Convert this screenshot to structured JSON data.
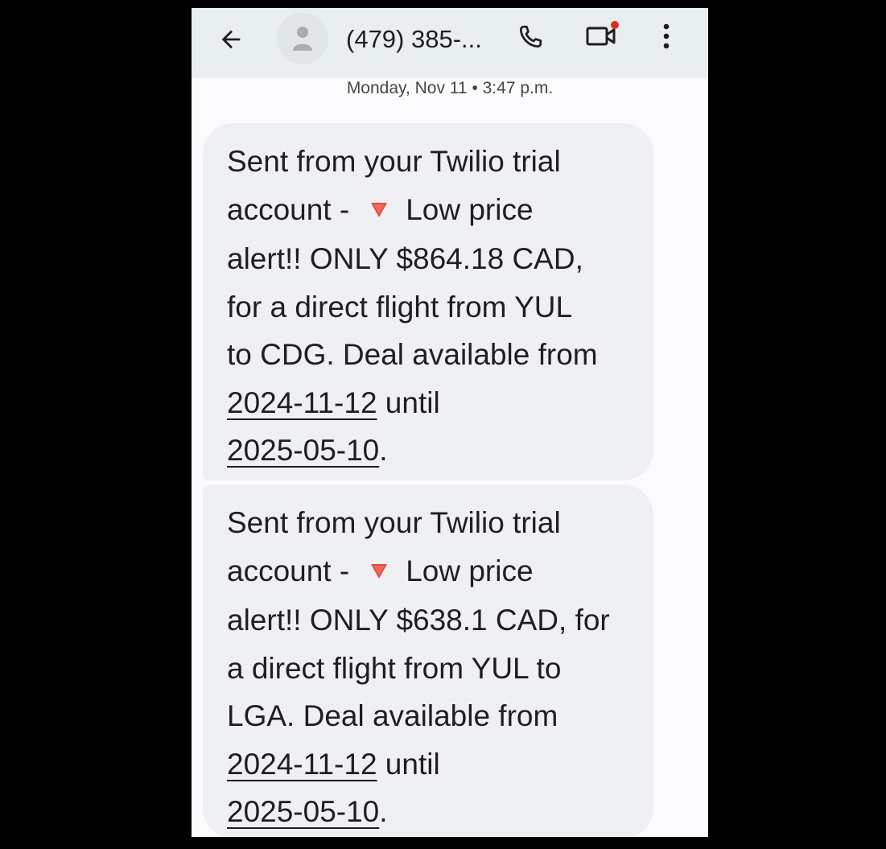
{
  "header": {
    "contact_name": "(479) 385-...",
    "icons": {
      "back": "arrow-back-icon",
      "avatar": "person-icon",
      "call": "phone-icon",
      "video": "video-call-icon",
      "more": "more-vert-icon"
    },
    "video_badge_color": "#d93025"
  },
  "conversation": {
    "timestamp": "Monday, Nov 11 • 3:47 p.m.",
    "messages": [
      {
        "line1": "Sent from your Twilio trial",
        "line2_pre": "account -",
        "alert_icon": "red-triangle-down-icon",
        "line2_post": "Low price",
        "line3": "alert!! ONLY $864.18 CAD,",
        "line4": "for a direct flight from YUL",
        "line5": "to CDG. Deal available from",
        "date_from": "2024-11-12",
        "until": " until",
        "date_to": "2025-05-10",
        "end": "."
      },
      {
        "line1": "Sent from your Twilio trial",
        "line2_pre": "account -",
        "alert_icon": "red-triangle-down-icon",
        "line2_post": "Low price",
        "line3": "alert!! ONLY $638.1 CAD, for",
        "line4": "a direct flight from YUL to",
        "line5": "LGA. Deal available from",
        "date_from": "2024-11-12",
        "until": " until",
        "date_to": "2025-05-10",
        "end": "."
      }
    ]
  },
  "colors": {
    "background": "#000000",
    "app_bar": "#e9eef0",
    "bubble": "#eff0f3",
    "alert_red": "#e5483b",
    "text": "#1f1f1f"
  }
}
